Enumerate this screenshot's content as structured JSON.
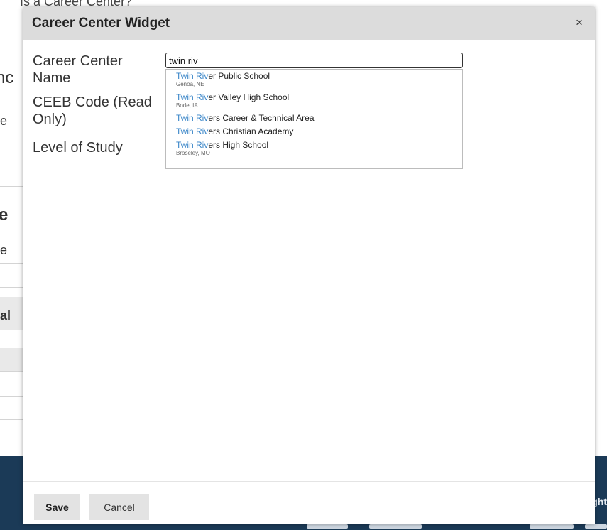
{
  "background": {
    "top_heading": "Is a Career Center?",
    "fragments": [
      "nc",
      "e",
      "e",
      "e",
      "al"
    ],
    "footer_text": "ght"
  },
  "dialog": {
    "title": "Career Center Widget",
    "close_label": "×",
    "fields": {
      "name_label": "Career Center Name",
      "ceeb_label": "CEEB Code (Read Only)",
      "level_label": "Level of Study",
      "name_value": "twin riv"
    },
    "suggestions": [
      {
        "match": "Twin Riv",
        "rest": "er Public School",
        "location": "Genoa, NE"
      },
      {
        "match": "Twin Riv",
        "rest": "er Valley High School",
        "location": "Bode, IA"
      },
      {
        "match": "Twin Riv",
        "rest": "ers Career & Technical Area",
        "location": ""
      },
      {
        "match": "Twin Riv",
        "rest": "ers Christian Academy",
        "location": ""
      },
      {
        "match": "Twin Riv",
        "rest": "ers High School",
        "location": "Broseley, MO"
      }
    ],
    "buttons": {
      "save": "Save",
      "cancel": "Cancel"
    }
  }
}
